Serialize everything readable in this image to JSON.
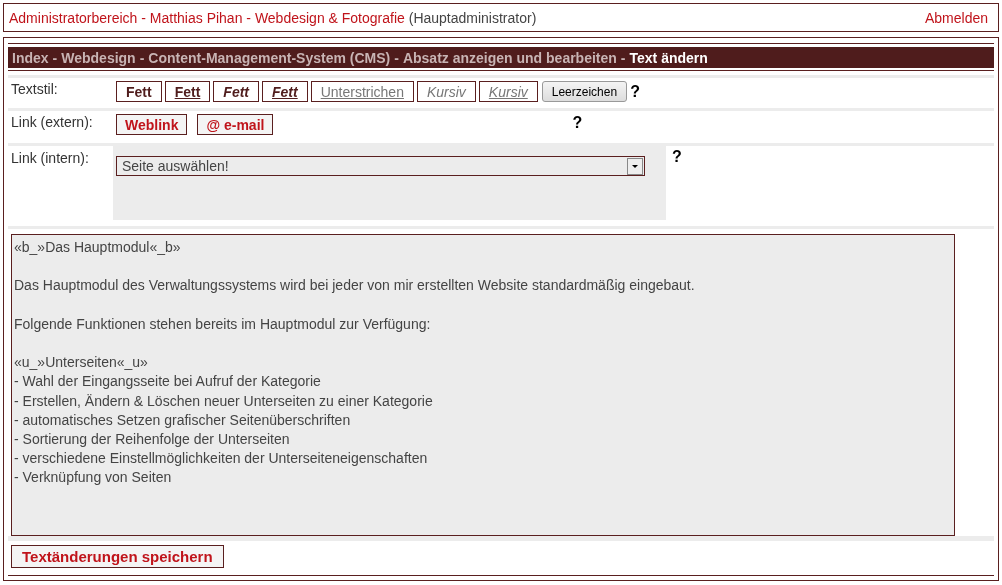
{
  "header": {
    "title": "Administratorbereich - Matthias Pihan - Webdesign & Fotografie",
    "role": "(Hauptadministrator)",
    "logout": "Abmelden"
  },
  "breadcrumb": {
    "separator": "-",
    "items": [
      {
        "label": "Index",
        "current": false
      },
      {
        "label": "Webdesign",
        "current": false
      },
      {
        "label": "Content-Management-System (CMS)",
        "current": false
      },
      {
        "label": "Absatz anzeigen und bearbeiten",
        "current": false
      },
      {
        "label": "Text ändern",
        "current": true
      }
    ]
  },
  "textstyle": {
    "label": "Textstil:",
    "help": "?",
    "buttons": [
      {
        "kind": "format",
        "label": "Fett",
        "bold": true,
        "italic": false,
        "underline": false
      },
      {
        "kind": "format",
        "label": "Fett",
        "bold": true,
        "italic": false,
        "underline": true
      },
      {
        "kind": "format",
        "label": "Fett",
        "bold": true,
        "italic": true,
        "underline": false
      },
      {
        "kind": "format",
        "label": "Fett",
        "bold": true,
        "italic": true,
        "underline": true
      },
      {
        "kind": "format",
        "label": "Unterstrichen",
        "bold": false,
        "italic": false,
        "underline": true
      },
      {
        "kind": "format",
        "label": "Kursiv",
        "bold": false,
        "italic": true,
        "underline": false
      },
      {
        "kind": "format",
        "label": "Kursiv",
        "bold": false,
        "italic": true,
        "underline": true
      },
      {
        "kind": "system",
        "label": "Leerzeichen",
        "bold": false,
        "italic": false,
        "underline": false
      }
    ]
  },
  "link_extern": {
    "label": "Link (extern):",
    "help": "?",
    "buttons": [
      "Weblink",
      "@ e-mail"
    ]
  },
  "link_intern": {
    "label": "Link (intern):",
    "help": "?",
    "select": {
      "value": "Seite auswählen!"
    }
  },
  "editor": {
    "paragraphs": [
      [
        "«b_»Das Hauptmodul«_b»"
      ],
      [
        "Das Hauptmodul des Verwaltungssystems wird bei jeder von mir erstellten Website standardmäßig eingebaut."
      ],
      [
        "Folgende Funktionen stehen bereits im Hauptmodul zur Verfügung:"
      ],
      [
        "«u_»Unterseiten«_u»",
        "- Wahl der Eingangsseite bei Aufruf der Kategorie",
        "- Erstellen, Ändern & Löschen neuer Unterseiten zu einer Kategorie",
        "- automatisches Setzen grafischer Seitenüberschriften",
        "- Sortierung der Reihenfolge der Unterseiten",
        "- verschiedene Einstellmöglichkeiten der Unterseiteneigenschaften",
        "- Verknüpfung von Seiten"
      ]
    ]
  },
  "save_button": "Textänderungen speichern"
}
